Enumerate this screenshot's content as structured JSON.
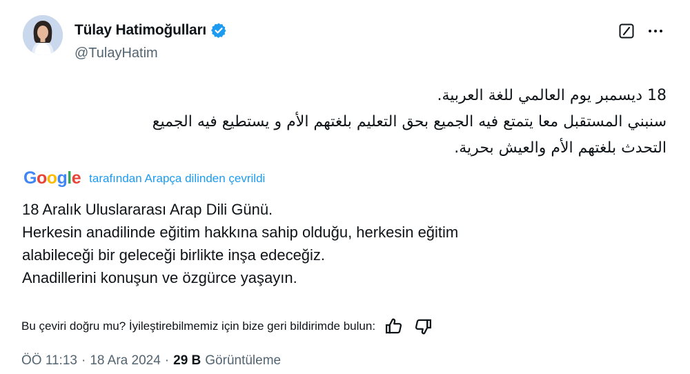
{
  "author": {
    "display_name": "Tülay Hatimoğulları",
    "handle": "@TulayHatim",
    "verified_icon": "verified-badge-icon"
  },
  "actions": {
    "grok_icon": "grok-icon",
    "more_icon": "more-icon"
  },
  "tweet": {
    "original_lines": [
      "18 ديسمبر يوم العالمي للغة العربية.",
      "سنبني المستقبل معا يتمتع فيه الجميع بحق التعليم بلغتهم الأم و يستطيع فيه الجميع",
      "التحدث بلغتهم الأم والعيش بحرية."
    ],
    "translation_provider": "Google",
    "translation_label": "tarafından Arapça dilinden çevrildi",
    "translated_lines": [
      "18 Aralık Uluslararası Arap Dili Günü.",
      "Herkesin anadilinde eğitim hakkına sahip olduğu, herkesin eğitim",
      "alabileceği bir geleceği birlikte inşa edeceğiz.",
      "Anadillerini konuşun ve özgürce yaşayın."
    ]
  },
  "feedback": {
    "question": "Bu çeviri doğru mu? İyileştirebilmemiz için bize geri bildirimde bulun:",
    "thumbs_up_icon": "thumbs-up-icon",
    "thumbs_down_icon": "thumbs-down-icon"
  },
  "meta": {
    "time": "ÖÖ 11:13",
    "separator": "·",
    "date": "18 Ara 2024",
    "views_count": "29 B",
    "views_label": "Görüntüleme"
  },
  "colors": {
    "accent": "#1d9bf0",
    "text_primary": "#0f1419",
    "text_secondary": "#536471"
  }
}
